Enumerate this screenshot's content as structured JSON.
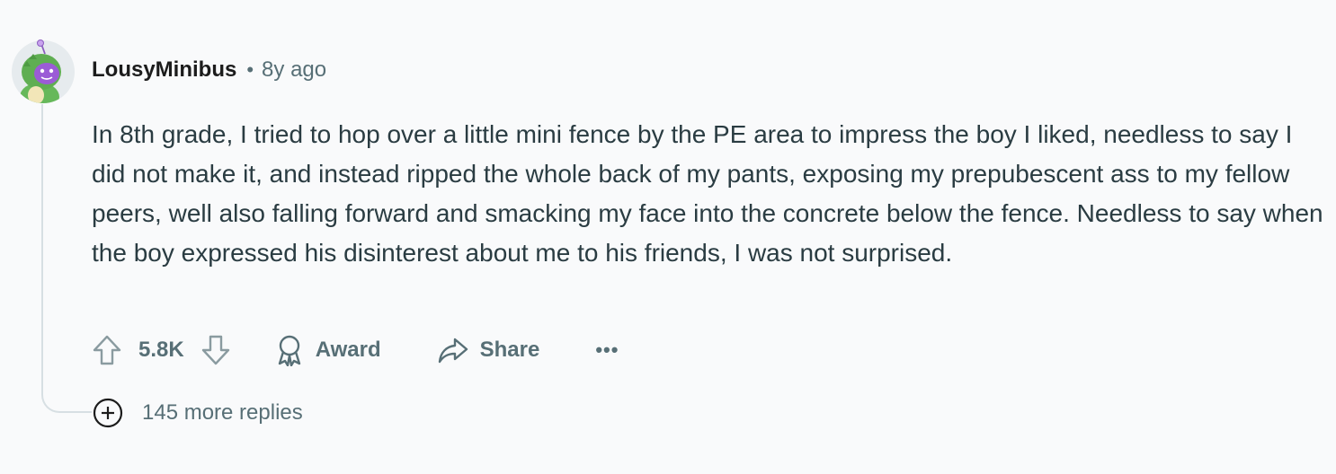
{
  "comment": {
    "author": "LousyMinibus",
    "separator": "•",
    "time": "8y ago",
    "body": "In 8th grade, I tried to hop over a little mini fence by the PE area to impress the boy I liked, needless to say I did not make it, and instead ripped the whole back of my pants, exposing my prepubescent ass to my fellow peers, well also falling forward and smacking my face into the concrete below the fence. Needless to say when the boy expressed his disinterest about me to his friends, I was not surprised.",
    "votes": "5.8K",
    "award_label": "Award",
    "share_label": "Share",
    "more_options": "•••",
    "more_replies_label": "145 more replies",
    "icons": {
      "avatar": "snoo-avatar-icon",
      "upvote": "upvote-arrow-icon",
      "downvote": "downvote-arrow-icon",
      "award": "award-ribbon-icon",
      "share": "share-arrow-icon",
      "expand": "plus-circle-icon"
    }
  },
  "colors": {
    "background": "#f9fafb",
    "text_primary": "#1c1c1c",
    "text_body": "#2a3c42",
    "text_meta": "#576f76",
    "thread_line": "#d7dfe3"
  }
}
